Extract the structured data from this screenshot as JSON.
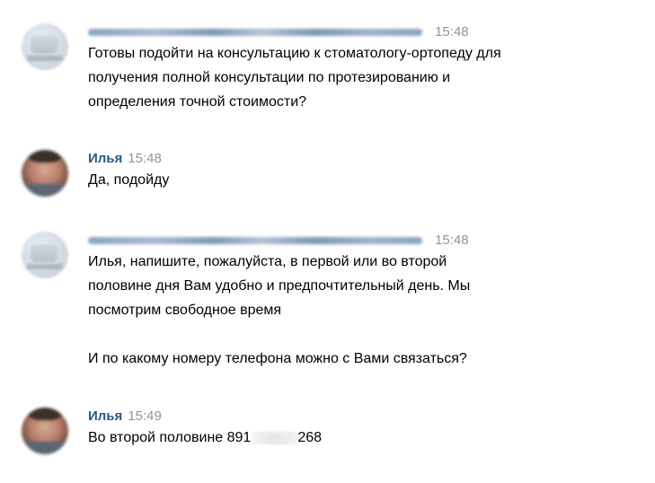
{
  "messages": [
    {
      "author": "",
      "time": "15:48",
      "lines": [
        "Готовы подойти на консультацию к стоматологу-ортопеду для",
        "получения полной консультации по протезированию и",
        "определения точной стоимости?"
      ]
    },
    {
      "author": "Илья",
      "time": "15:48",
      "lines": [
        "Да, подойду"
      ]
    },
    {
      "author": "",
      "time": "15:48",
      "lines": [
        "Илья, напишите, пожалуйста, в первой или во второй",
        "половине дня Вам удобно и предпочтительный день. Мы",
        "посмотрим свободное время",
        "",
        "И по какому номеру телефона можно с Вами связаться?"
      ]
    },
    {
      "author": "Илья",
      "time": "15:49",
      "text_before": "Во второй половине 891",
      "text_after": "268"
    }
  ]
}
